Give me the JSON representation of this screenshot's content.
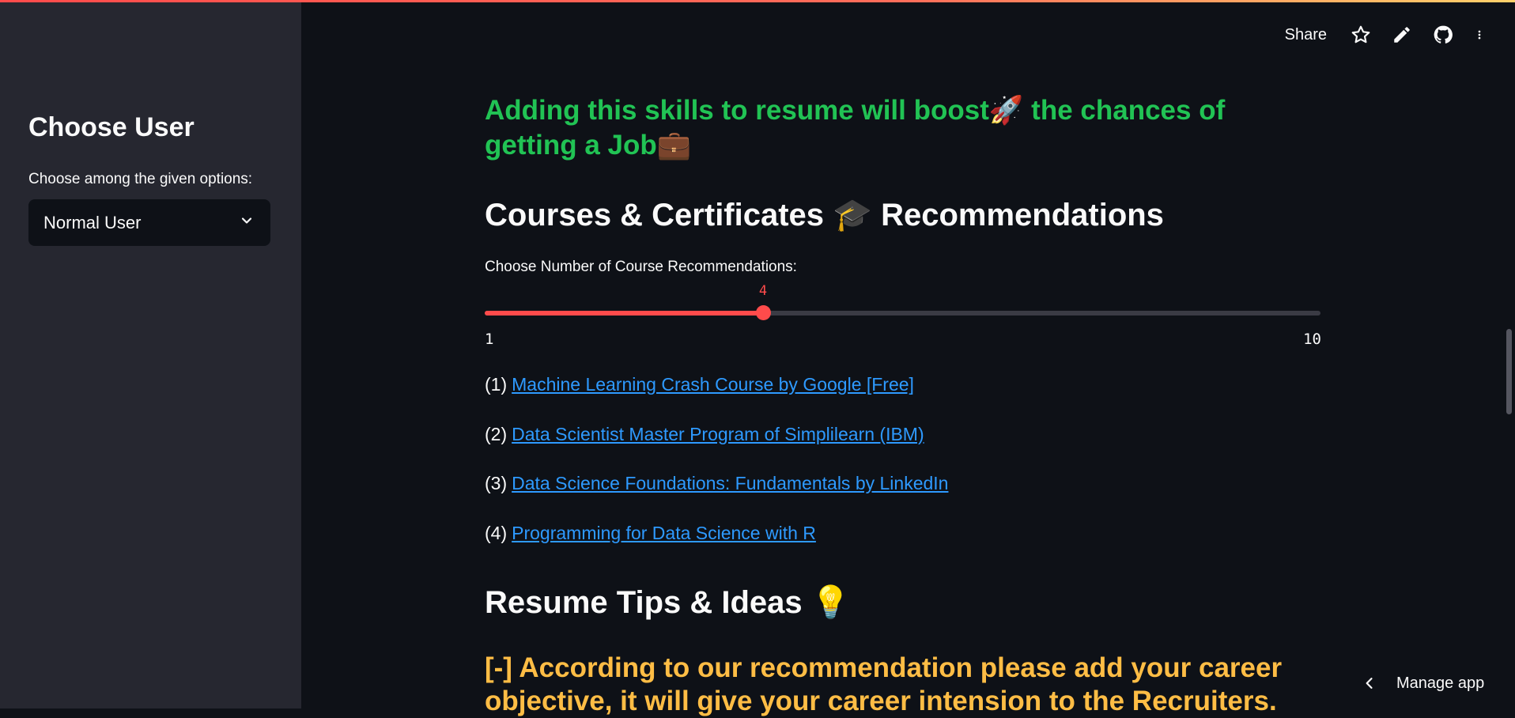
{
  "sidebar": {
    "title": "Choose User",
    "select_label": "Choose among the given options:",
    "selected_value": "Normal User"
  },
  "header": {
    "share_label": "Share",
    "icons": [
      "star-icon",
      "pencil-icon",
      "github-icon",
      "more-vertical-icon"
    ]
  },
  "main": {
    "skills_message": "Adding this skills to resume will boost🚀 the chances of getting a Job💼",
    "courses_heading": "Courses & Certificates 🎓 Recommendations",
    "slider": {
      "label": "Choose Number of Course Recommendations:",
      "value": "4",
      "value_num": 4,
      "min": "1",
      "max": "10",
      "min_num": 1,
      "max_num": 10
    },
    "courses": [
      {
        "num": "(1)",
        "title": "Machine Learning Crash Course by Google [Free]"
      },
      {
        "num": "(2)",
        "title": "Data Scientist Master Program of Simplilearn (IBM)"
      },
      {
        "num": "(3)",
        "title": "Data Science Foundations: Fundamentals by LinkedIn"
      },
      {
        "num": "(4)",
        "title": "Programming for Data Science with R"
      }
    ],
    "tips_heading": "Resume Tips & Ideas 💡",
    "tip_text": "[-] According to our recommendation please add your career objective, it will give your career intension to the Recruiters."
  },
  "footer": {
    "manage_label": "Manage app"
  },
  "colors": {
    "accent": "#ff4b4b",
    "success": "#21c354",
    "warning": "#ffbd45",
    "link": "#2e9aff",
    "background": "#0e1117",
    "sidebar_bg": "#262730"
  }
}
